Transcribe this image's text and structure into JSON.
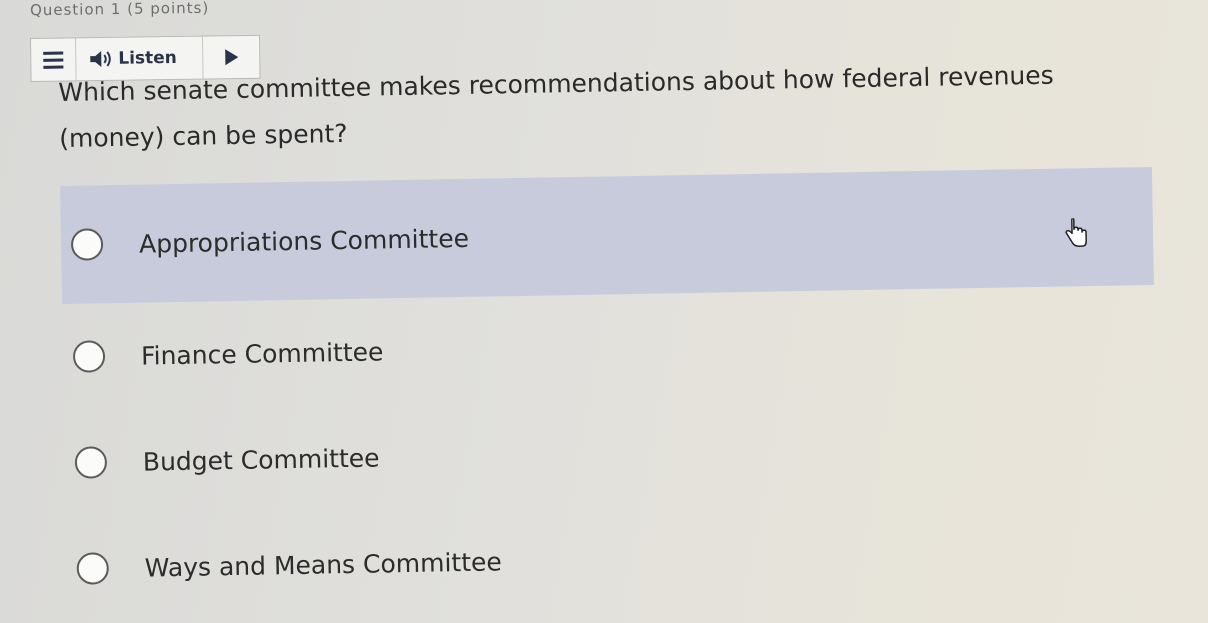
{
  "header": {
    "text": "Question 1 (5 points)"
  },
  "toolbar": {
    "listen_label": "Listen"
  },
  "question": {
    "line1": "Which senate committee makes recommendations about how federal revenues",
    "line2": "(money) can be spent?"
  },
  "options": [
    {
      "label": "Appropriations Committee",
      "hovered": true
    },
    {
      "label": "Finance Committee",
      "hovered": false
    },
    {
      "label": "Budget Committee",
      "hovered": false
    },
    {
      "label": "Ways and Means Committee",
      "hovered": false
    }
  ],
  "colors": {
    "hover_background": "#c8cbdc",
    "toolbar_icon": "#2a3348"
  },
  "icons": {
    "menu": "hamburger-icon",
    "speaker": "speaker-icon",
    "play": "play-icon",
    "cursor": "hand-pointer-icon"
  }
}
